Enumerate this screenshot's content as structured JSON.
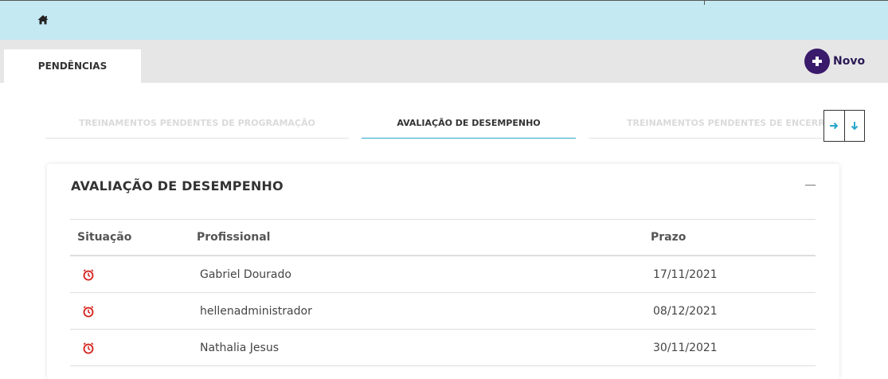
{
  "header": {
    "home_icon": "home-icon"
  },
  "tabs": [
    {
      "label": "PENDÊNCIAS",
      "active": true
    }
  ],
  "actions": {
    "new_label": "Novo",
    "new_icon": "plus-circle-icon"
  },
  "subtabs": [
    {
      "label": "TREINAMENTOS PENDENTES DE PROGRAMAÇÃO",
      "active": false
    },
    {
      "label": "AVALIAÇÃO DE DESEMPENHO",
      "active": true
    },
    {
      "label": "TREINAMENTOS PENDENTES DE ENCERRA",
      "active": false
    }
  ],
  "nav": {
    "next_icon": "arrow-right-icon",
    "down_icon": "arrow-down-icon"
  },
  "section": {
    "title": "AVALIAÇÃO DE DESEMPENHO",
    "collapse_icon": "minus-icon",
    "columns": [
      "Situação",
      "Profissional",
      "Prazo"
    ],
    "rows": [
      {
        "status_icon": "alarm-clock-icon",
        "professional": "Gabriel Dourado",
        "deadline": "17/11/2021"
      },
      {
        "status_icon": "alarm-clock-icon",
        "professional": "hellenadministrador",
        "deadline": "08/12/2021"
      },
      {
        "status_icon": "alarm-clock-icon",
        "professional": "Nathalia Jesus",
        "deadline": "30/11/2021"
      }
    ]
  },
  "colors": {
    "topbar": "#c5e9f2",
    "tabstrip": "#e6e6e6",
    "accent": "#2aa7c9",
    "new_button": "#3a1a6b",
    "status_icon": "#d62020"
  }
}
